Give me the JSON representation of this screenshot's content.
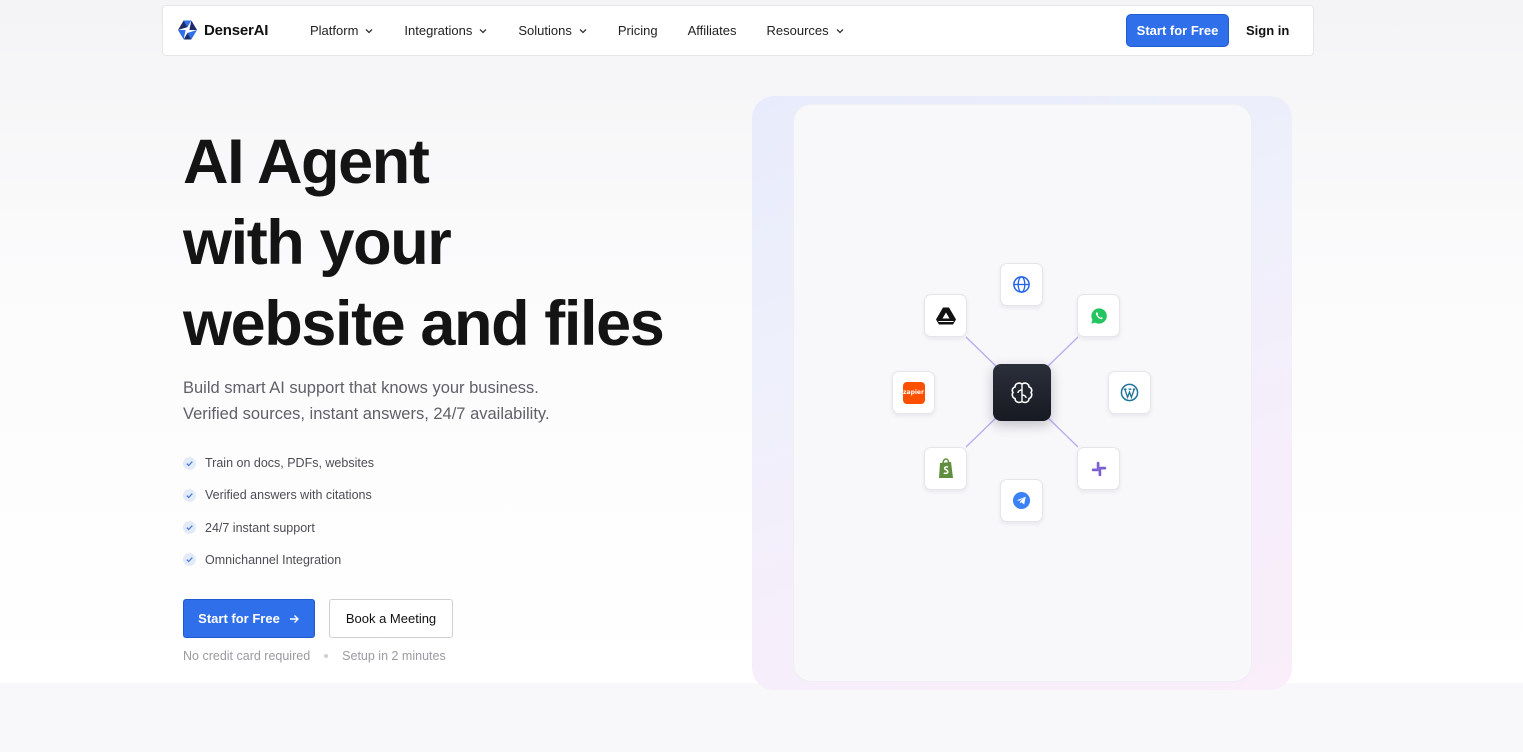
{
  "nav": {
    "brand": "DenserAI",
    "links": [
      {
        "label": "Platform",
        "dropdown": true
      },
      {
        "label": "Integrations",
        "dropdown": true
      },
      {
        "label": "Solutions",
        "dropdown": true
      },
      {
        "label": "Pricing",
        "dropdown": false
      },
      {
        "label": "Affiliates",
        "dropdown": false
      },
      {
        "label": "Resources",
        "dropdown": true
      }
    ],
    "cta_label": "Start for Free",
    "signin_label": "Sign in"
  },
  "hero": {
    "headline": [
      "AI Agent",
      "with your",
      "website and files"
    ],
    "subtitle": [
      "Build smart AI support that knows your business.",
      "Verified sources, instant answers, 24/7 availability."
    ],
    "features": [
      "Train on docs, PDFs, websites",
      "Verified answers with citations",
      "24/7 instant support",
      "Omnichannel Integration"
    ],
    "primary_cta": "Start for Free",
    "secondary_cta": "Book a Meeting",
    "notes": [
      "No credit card required",
      "Setup in 2 minutes"
    ]
  },
  "integrations": {
    "center": "brain-icon",
    "tiles": [
      {
        "name": "globe-icon",
        "color": "#2563eb"
      },
      {
        "name": "whatsapp-icon",
        "color": "#22c55e"
      },
      {
        "name": "wordpress-icon",
        "color": "#21759b"
      },
      {
        "name": "slack-icon",
        "color": "#7c5fd1"
      },
      {
        "name": "telegram-icon",
        "color": "#3b82f6"
      },
      {
        "name": "shopify-icon",
        "color": "#5e8e3e"
      },
      {
        "name": "zapier-icon",
        "color": "#ff4f00",
        "label": "zapier"
      },
      {
        "name": "google-drive-icon",
        "color": "#111111"
      }
    ]
  },
  "colors": {
    "accent": "#2f6fe9",
    "line": "#b8aef0"
  }
}
